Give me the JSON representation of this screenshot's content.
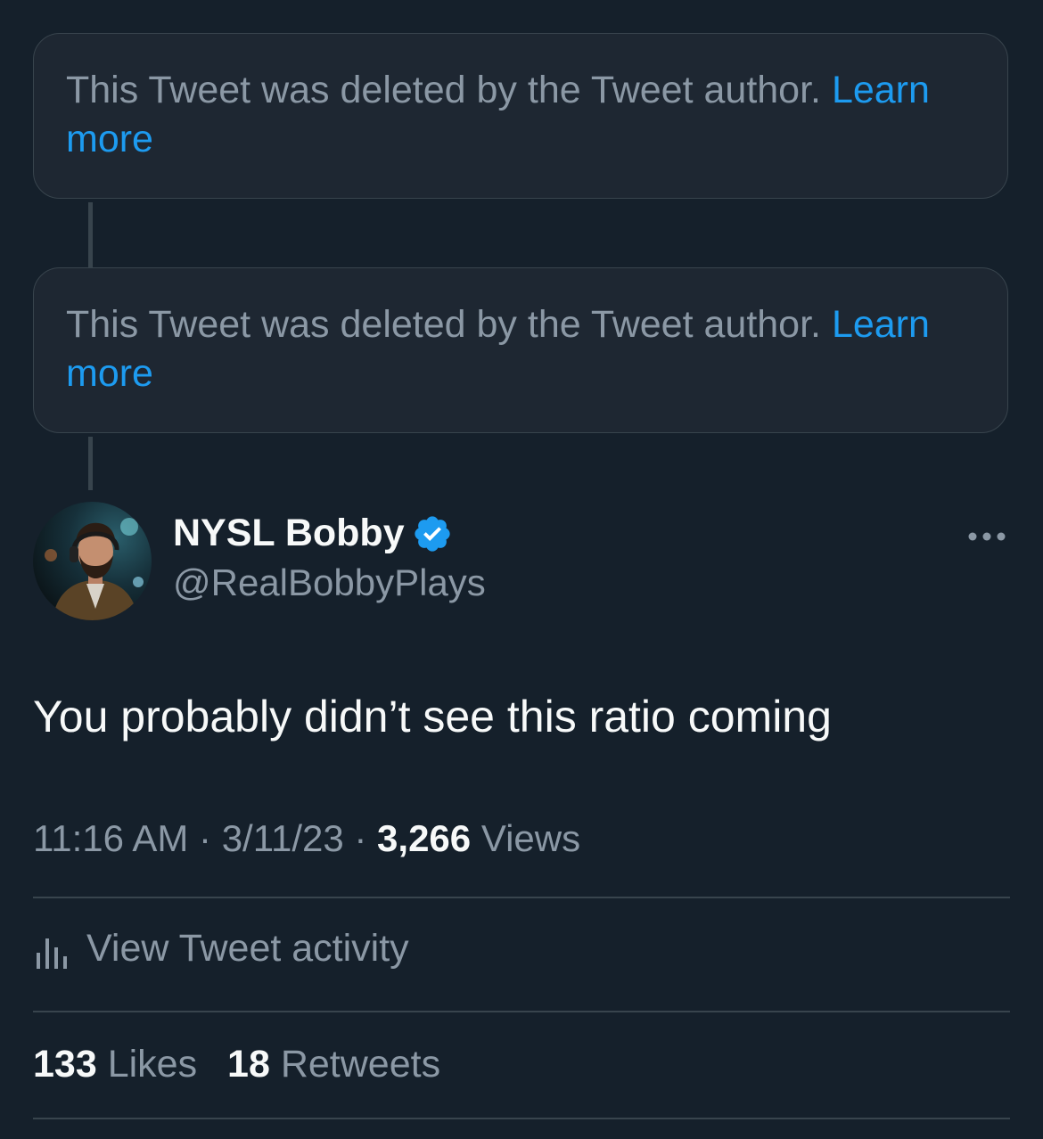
{
  "deleted_notices": [
    {
      "text": "This Tweet was deleted by the Tweet author.",
      "link": "Learn more"
    },
    {
      "text": "This Tweet was deleted by the Tweet author.",
      "link": "Learn more"
    }
  ],
  "author": {
    "name": "NYSL Bobby",
    "handle": "@RealBobbyPlays",
    "verified": true
  },
  "tweet": {
    "text": "You probably didn’t see this ratio coming",
    "time": "11:16 AM",
    "date": "3/11/23",
    "views_count": "3,266",
    "views_label": "Views",
    "separator": "·"
  },
  "activity": {
    "label": "View Tweet activity"
  },
  "stats": {
    "likes_count": "133",
    "likes_label": "Likes",
    "retweets_count": "18",
    "retweets_label": "Retweets"
  },
  "colors": {
    "background": "#15202b",
    "accent": "#1d9bf0",
    "secondary_text": "#8b98a5",
    "border": "#38444d"
  },
  "icons": {
    "more": "more-horizontal-icon",
    "verified": "verified-badge-icon",
    "activity": "bar-chart-icon"
  }
}
